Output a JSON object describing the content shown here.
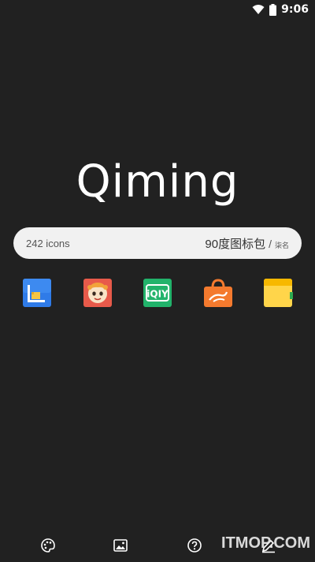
{
  "status_bar": {
    "time": "9:06",
    "icons": [
      "wifi-icon",
      "battery-icon"
    ]
  },
  "app": {
    "title": "Qiming"
  },
  "info_pill": {
    "icon_count": "242 icons",
    "pack_name": "90度图标包",
    "separator": "/",
    "tag": "柒名"
  },
  "preview_icons": [
    {
      "name": "blue-ruler-app-icon",
      "color": "#2f7be8"
    },
    {
      "name": "red-cartoon-app-icon",
      "color": "#e85a4a"
    },
    {
      "name": "iqiyi-app-icon",
      "color": "#22b36b",
      "text": "iQIY"
    },
    {
      "name": "orange-shopping-bag-app-icon",
      "color": "#f47a2e"
    },
    {
      "name": "yellow-notes-app-icon",
      "color": "#ffd54a"
    }
  ],
  "bottom_nav": [
    {
      "name": "theme-palette-icon"
    },
    {
      "name": "wallpaper-image-icon"
    },
    {
      "name": "help-question-icon"
    },
    {
      "name": "edit-pencil-icon"
    }
  ],
  "watermark": "ITMOP.COM"
}
